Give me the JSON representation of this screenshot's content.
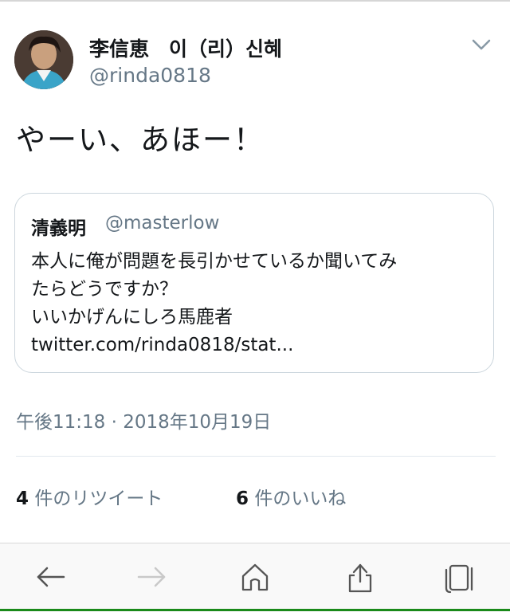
{
  "tweet": {
    "author_name": "李信恵　이（리）신혜",
    "author_handle": "@rinda0818",
    "text": "やーい、あほー！",
    "timestamp": "午後11:18 · 2018年10月19日"
  },
  "quote": {
    "author_name": "清義明",
    "author_handle": "@masterlow",
    "lines": [
      "本人に俺が問題を長引かせているか聞いてみ",
      "たらどうですか？",
      "いいかげんにしろ馬鹿者",
      "twitter.com/rinda0818/stat..."
    ]
  },
  "stats": {
    "retweets_count": "4",
    "retweets_label": "件のリツイート",
    "likes_count": "6",
    "likes_label": "件のいいね"
  },
  "toolbar": {
    "icons": [
      "back-icon",
      "forward-icon",
      "home-icon",
      "share-icon",
      "tabs-icon"
    ]
  },
  "colors": {
    "text_primary": "#14171a",
    "text_secondary": "#657786",
    "border": "#ccd6dd",
    "toolbar_bg": "#f9f9f9"
  }
}
